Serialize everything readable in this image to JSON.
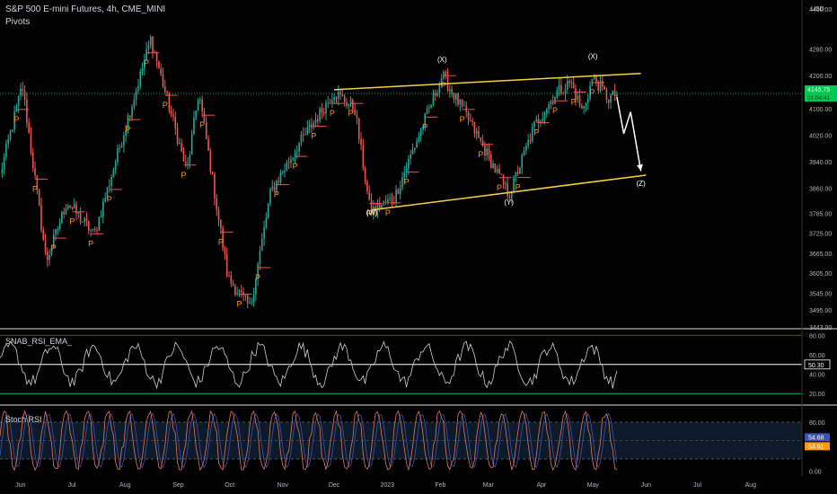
{
  "header": {
    "title": "S&P 500 E-mini Futures, 4h, CME_MINI",
    "indicator": "Pivots"
  },
  "price_axis": {
    "currency": "USD",
    "ticks": [
      "4400.00",
      "4280.00",
      "4200.00",
      "4100.00",
      "4020.00",
      "3940.00",
      "3860.00",
      "3785.00",
      "3725.00",
      "3665.00",
      "3605.00",
      "3545.00",
      "3495.00",
      "3443.00"
    ],
    "price_badge": "4145.75",
    "countdown_badge": "01:04:41"
  },
  "rsi_panel": {
    "label": "SNAB_RSI_EMA_",
    "ticks": [
      "80.00",
      "60.00",
      "40.00",
      "20.00"
    ],
    "value_badge": "50.30"
  },
  "stoch_panel": {
    "label": "Stoch RSI",
    "ticks": [
      "80.00",
      "0.00"
    ],
    "k_badge": "54.68",
    "d_badge": "53.91"
  },
  "time_axis": [
    "Jun",
    "Jul",
    "Aug",
    "Sep",
    "Oct",
    "Nov",
    "Dec",
    "2023",
    "Feb",
    "Mar",
    "Apr",
    "May",
    "Jun",
    "Jul",
    "Aug"
  ],
  "wave_labels": [
    "(W)",
    "(X)",
    "(Y)",
    "(X)",
    "(Z)"
  ],
  "colors": {
    "up": "#26a69a",
    "down": "#ef5350",
    "trendline": "#f5d142",
    "pivot_marker": "#ff9800",
    "price_badge": "#00c853",
    "rsi_ref_top": "#b71c1c",
    "rsi_ref_bottom": "#00c853",
    "stoch_k": "#e07a5f",
    "stoch_d": "#3f51b5"
  },
  "chart_data": {
    "type": "candlestick",
    "timeframe": "4h",
    "x_range": [
      "2022-05-20",
      "2023-08-31"
    ],
    "y_range": [
      3443,
      4400
    ],
    "price_path": [
      {
        "date": "2022-05-20",
        "price": 3900
      },
      {
        "date": "2022-06-02",
        "price": 4170
      },
      {
        "date": "2022-06-16",
        "price": 3640
      },
      {
        "date": "2022-06-28",
        "price": 3820
      },
      {
        "date": "2022-07-14",
        "price": 3720
      },
      {
        "date": "2022-08-16",
        "price": 4310
      },
      {
        "date": "2022-09-06",
        "price": 3910
      },
      {
        "date": "2022-09-13",
        "price": 4150
      },
      {
        "date": "2022-09-30",
        "price": 3590
      },
      {
        "date": "2022-10-13",
        "price": 3500
      },
      {
        "date": "2022-10-25",
        "price": 3850
      },
      {
        "date": "2022-11-10",
        "price": 3990
      },
      {
        "date": "2022-12-01",
        "price": 4150
      },
      {
        "date": "2022-12-13",
        "price": 4100
      },
      {
        "date": "2022-12-22",
        "price": 3790
      },
      {
        "date": "2023-01-05",
        "price": 3830
      },
      {
        "date": "2023-02-02",
        "price": 4200
      },
      {
        "date": "2023-02-16",
        "price": 4080
      },
      {
        "date": "2023-03-13",
        "price": 3840
      },
      {
        "date": "2023-03-28",
        "price": 4050
      },
      {
        "date": "2023-04-10",
        "price": 4150
      },
      {
        "date": "2023-04-18",
        "price": 4180
      },
      {
        "date": "2023-04-25",
        "price": 4090
      },
      {
        "date": "2023-05-01",
        "price": 4195
      },
      {
        "date": "2023-05-10",
        "price": 4130
      },
      {
        "date": "2023-05-15",
        "price": 4145
      }
    ],
    "trendlines": [
      {
        "from": {
          "date": "2022-12-01",
          "price": 4157
        },
        "to": {
          "date": "2023-05-29",
          "price": 4206
        }
      },
      {
        "from": {
          "date": "2022-12-23",
          "price": 3795
        },
        "to": {
          "date": "2023-06-01",
          "price": 3900
        }
      }
    ],
    "projection": [
      {
        "date": "2023-05-15",
        "price": 4135
      },
      {
        "date": "2023-05-19",
        "price": 4025
      },
      {
        "date": "2023-05-23",
        "price": 4090
      },
      {
        "date": "2023-05-29",
        "price": 3912
      }
    ],
    "wave_points": [
      {
        "label": "(W)",
        "date": "2022-12-23",
        "price": 3780
      },
      {
        "label": "(X)",
        "date": "2023-02-02",
        "price": 4240
      },
      {
        "label": "(Y)",
        "date": "2023-03-13",
        "price": 3810
      },
      {
        "label": "(X)",
        "date": "2023-05-01",
        "price": 4250
      },
      {
        "label": "(Z)",
        "date": "2023-05-29",
        "price": 3867
      }
    ],
    "current_price": 4145.75,
    "rsi_ema": {
      "range": [
        10,
        85
      ],
      "ref_levels": [
        80,
        20
      ],
      "current": 50.3
    },
    "stoch_rsi": {
      "range": [
        -5,
        105
      ],
      "bands": [
        80,
        20
      ],
      "k": 54.68,
      "d": 53.91
    }
  }
}
